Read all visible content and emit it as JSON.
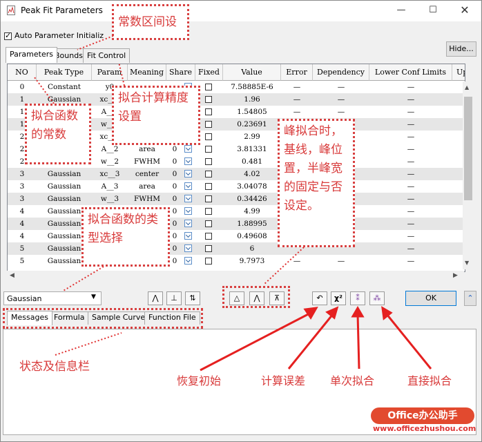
{
  "window": {
    "title": "Peak Fit Parameters",
    "minimize_icon": "minimize-icon",
    "maximize_icon": "maximize-icon",
    "close_icon": "close-icon"
  },
  "auto_param": {
    "label": "Auto Parameter Initializ",
    "checked": true
  },
  "hide_button": "Hide...",
  "tabs": [
    "Parameters",
    "Bounds",
    "Fit Control"
  ],
  "table": {
    "columns": [
      "NO",
      "Peak Type",
      "Param",
      "Meaning",
      "Share",
      "Fixed",
      "Value",
      "Error",
      "Dependency",
      "Lower Conf Limits",
      "Upp"
    ],
    "rows": [
      {
        "no": "0",
        "type": "Constant",
        "param": "y0",
        "meaning": "",
        "share": "",
        "value": "7.58885E-6",
        "error": "—",
        "dep": "—",
        "lower": "—"
      },
      {
        "no": "1",
        "type": "Gaussian",
        "param": "xc__1",
        "meaning": "",
        "share": "",
        "value": "1.96",
        "error": "—",
        "dep": "—",
        "lower": "—"
      },
      {
        "no": "1",
        "type": "",
        "param": "A__1",
        "meaning": "",
        "share": "",
        "value": "1.54805",
        "error": "—",
        "dep": "—",
        "lower": "—"
      },
      {
        "no": "1",
        "type": "",
        "param": "w__1",
        "meaning": "",
        "share": "",
        "value": "0.23691",
        "error": "—",
        "dep": "—",
        "lower": "—"
      },
      {
        "no": "2",
        "type": "",
        "param": "xc__2",
        "meaning": "",
        "share": "",
        "value": "2.99",
        "error": "—",
        "dep": "—",
        "lower": "—"
      },
      {
        "no": "2",
        "type": "",
        "param": "A__2",
        "meaning": "area",
        "share": "0",
        "value": "3.81331",
        "error": "—",
        "dep": "—",
        "lower": "—"
      },
      {
        "no": "2",
        "type": "",
        "param": "w__2",
        "meaning": "FWHM",
        "share": "0",
        "value": "0.481",
        "error": "—",
        "dep": "—",
        "lower": "—"
      },
      {
        "no": "3",
        "type": "Gaussian",
        "param": "xc__3",
        "meaning": "center",
        "share": "0",
        "value": "4.02",
        "error": "—",
        "dep": "—",
        "lower": "—"
      },
      {
        "no": "3",
        "type": "Gaussian",
        "param": "A__3",
        "meaning": "area",
        "share": "0",
        "value": "3.04078",
        "error": "—",
        "dep": "—",
        "lower": "—"
      },
      {
        "no": "3",
        "type": "Gaussian",
        "param": "w__3",
        "meaning": "FWHM",
        "share": "0",
        "value": "0.34426",
        "error": "—",
        "dep": "—",
        "lower": "—"
      },
      {
        "no": "4",
        "type": "Gaussian",
        "param": "",
        "meaning": "",
        "share": "0",
        "value": "4.99",
        "error": "",
        "dep": "",
        "lower": "—"
      },
      {
        "no": "4",
        "type": "Gaussian",
        "param": "",
        "meaning": "",
        "share": "0",
        "value": "1.88995",
        "error": "",
        "dep": "",
        "lower": "—"
      },
      {
        "no": "4",
        "type": "Gaussian",
        "param": "",
        "meaning": "",
        "share": "0",
        "value": "0.49608",
        "error": "",
        "dep": "",
        "lower": "—"
      },
      {
        "no": "5",
        "type": "Gaussian",
        "param": "",
        "meaning": "",
        "share": "0",
        "value": "6",
        "error": "",
        "dep": "",
        "lower": "—"
      },
      {
        "no": "5",
        "type": "Gaussian",
        "param": "",
        "meaning": "",
        "share": "0",
        "value": "9.7973",
        "error": "—",
        "dep": "—",
        "lower": "—"
      }
    ]
  },
  "peak_type_select": "Gaussian",
  "ok_button": "OK",
  "bottom_tabs": [
    "Messages",
    "Formula",
    "Sample Curve",
    "Function File"
  ],
  "annotations": {
    "const_range": "常数区间设",
    "fit_const": "拟合函数的常数",
    "precision": "拟合计算精度设置",
    "fixed_setting": "峰拟合时，基线，峰位置，半峰宽的固定与否设定。",
    "type_select": "拟合函数的类型选择",
    "status_bar": "状态及信息栏",
    "restore": "恢复初始",
    "calc_error": "计算误差",
    "single_fit": "单次拟合",
    "direct_fit": "直接拟合"
  },
  "watermark": {
    "brand": "Office办公助手",
    "url": "www.officezhushou.com"
  },
  "colors": {
    "annotation": "#d83a3a",
    "select_border": "#5b8dc8",
    "ok_border": "#0078d7"
  }
}
